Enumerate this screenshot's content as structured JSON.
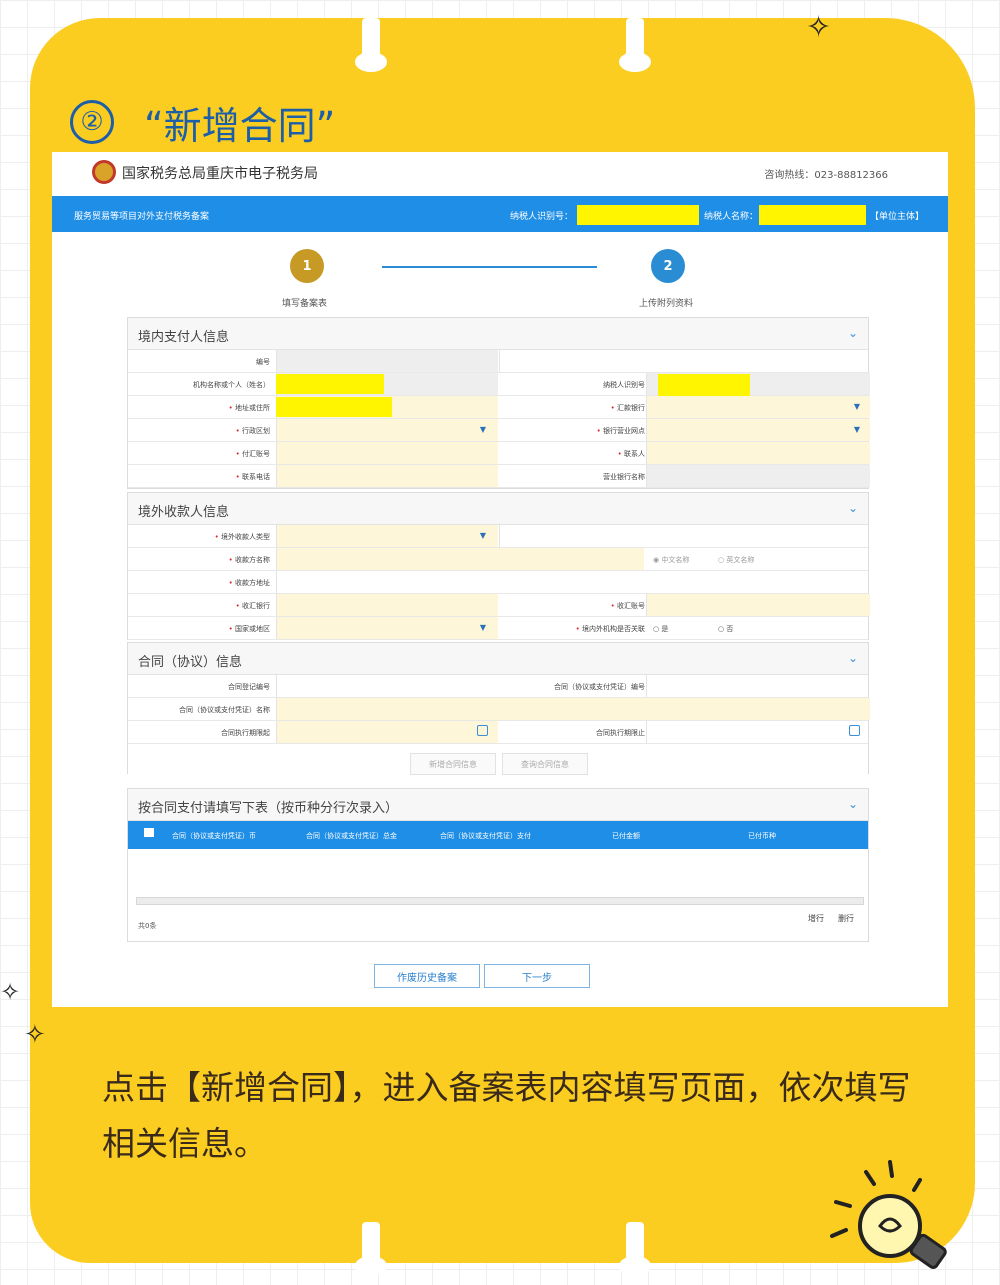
{
  "heading": {
    "number": "②",
    "text": "“新增合同”"
  },
  "site": {
    "title": "国家税务总局重庆市电子税务局",
    "hotline": "咨询热线：023-88812366"
  },
  "bluebar": {
    "module": "服务贸易等项目对外支付税务备案",
    "taxpayer_id_label": "纳税人识别号：",
    "taxpayer_name_label": "纳税人名称：",
    "role": "【单位主体】"
  },
  "steps": [
    {
      "num": "1",
      "label": "填写备案表",
      "color": "#c79a25"
    },
    {
      "num": "2",
      "label": "上传附列资料",
      "color": "#2a8dd4"
    }
  ],
  "domestic": {
    "title": "境内支付人信息",
    "rows": {
      "serial": "编号",
      "org_name": "机构名称或个人（姓名）",
      "taxpayer_id": "纳税人识别号",
      "address": "地址或住所",
      "remit_bank": "汇款银行",
      "admin_region": "行政区划",
      "bank_branch": "银行营业网点",
      "pay_account": "付汇账号",
      "contact": "联系人",
      "phone": "联系电话",
      "branch_name": "营业银行名称"
    }
  },
  "foreign": {
    "title": "境外收款人信息",
    "rows": {
      "payee_type": "境外收款人类型",
      "payee_name": "收款方名称",
      "name_cn": "中文名称",
      "name_en": "英文名称",
      "payee_address": "收款方地址",
      "recv_bank": "收汇银行",
      "recv_account": "收汇账号",
      "country": "国家或地区",
      "related": "境内外机构是否关联",
      "yes": "是",
      "no": "否"
    }
  },
  "contract": {
    "title": "合同（协议）信息",
    "rows": {
      "reg_no": "合同登记编号",
      "contract_no": "合同（协议或支付凭证）编号",
      "contract_name": "合同（协议或支付凭证）名称",
      "start": "合同执行期限起",
      "end": "合同执行期限止"
    },
    "add_btn": "新增合同信息",
    "query_btn": "查询合同信息"
  },
  "payment": {
    "title": "按合同支付请填写下表（按币种分行次录入）",
    "columns": [
      "合同（协议或支付凭证）币",
      "合同（协议或支付凭证）总金",
      "合同（协议或支付凭证）支付",
      "已付金额",
      "已付币种"
    ],
    "add_row": "增行",
    "del_row": "删行",
    "total": "共0条"
  },
  "footer_buttons": {
    "history": "作废历史备案",
    "next": "下一步"
  },
  "caption": "点击【新增合同】，进入备案表内容填写页面，依次填写相关信息。",
  "colors": {
    "card": "#fccd21",
    "heading": "#1c5fa8",
    "bar": "#1f8ee6",
    "mask": "#fff500"
  }
}
